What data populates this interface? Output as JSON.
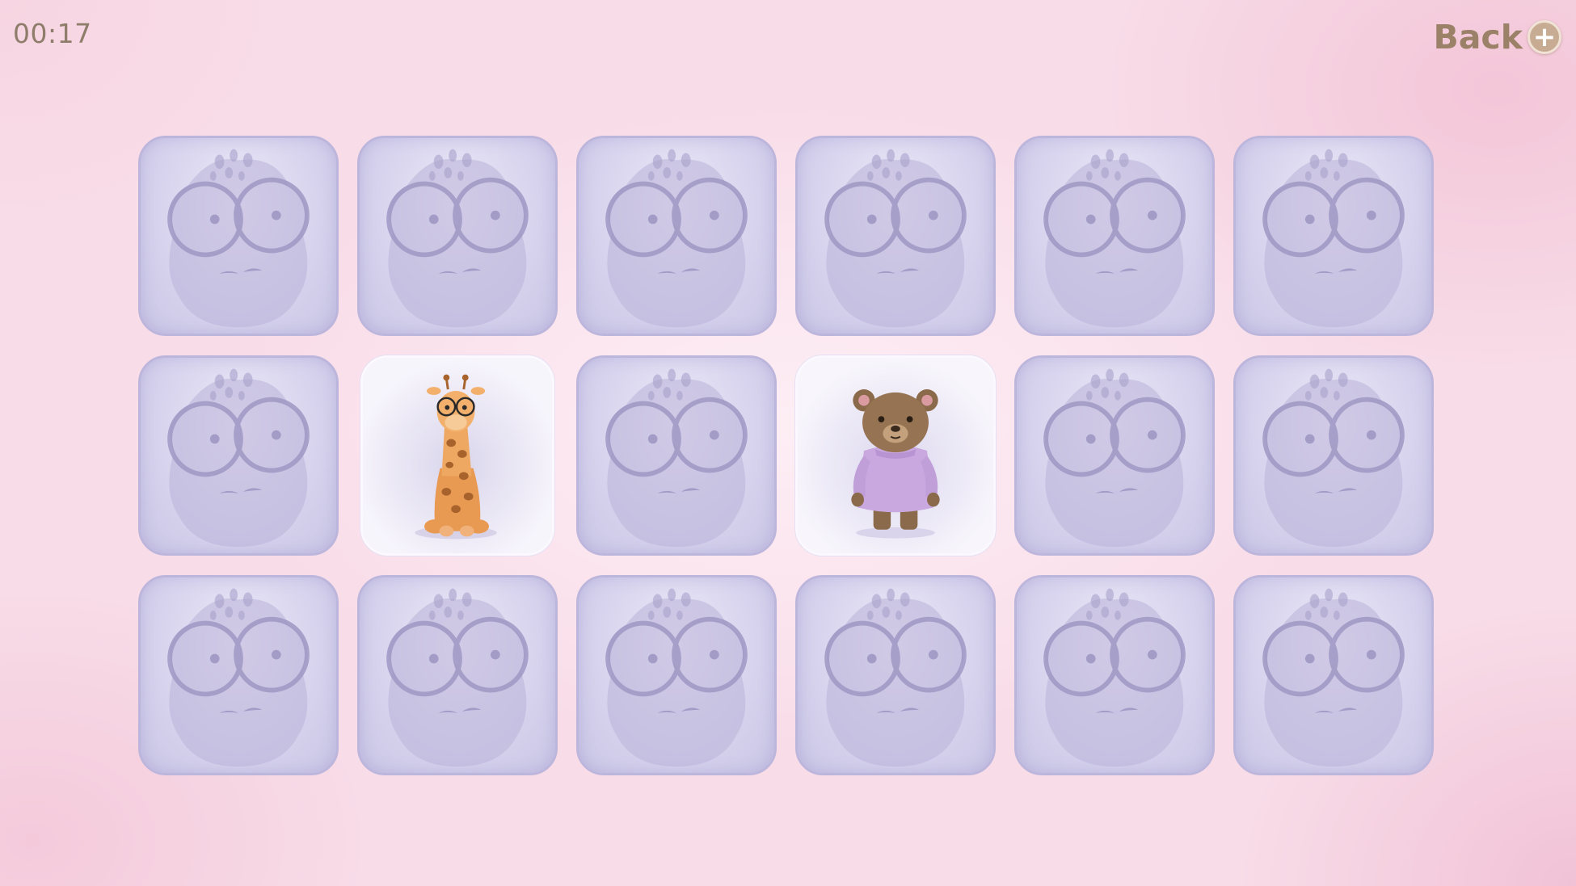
{
  "header": {
    "timer": "00:17",
    "back_label": "Back",
    "back_icon": "plus-circle-icon"
  },
  "board": {
    "rows": 3,
    "columns": 6,
    "cards": [
      {
        "state": "face-down",
        "image": "giraffe-silhouette-back"
      },
      {
        "state": "face-down",
        "image": "giraffe-silhouette-back"
      },
      {
        "state": "face-down",
        "image": "giraffe-silhouette-back"
      },
      {
        "state": "face-down",
        "image": "giraffe-silhouette-back"
      },
      {
        "state": "face-down",
        "image": "giraffe-silhouette-back"
      },
      {
        "state": "face-down",
        "image": "giraffe-silhouette-back"
      },
      {
        "state": "face-down",
        "image": "giraffe-silhouette-back"
      },
      {
        "state": "face-up",
        "image": "giraffe-with-glasses"
      },
      {
        "state": "face-down",
        "image": "giraffe-silhouette-back"
      },
      {
        "state": "face-up",
        "image": "bear-in-purple-sweater"
      },
      {
        "state": "face-down",
        "image": "giraffe-silhouette-back"
      },
      {
        "state": "face-down",
        "image": "giraffe-silhouette-back"
      },
      {
        "state": "face-down",
        "image": "giraffe-silhouette-back"
      },
      {
        "state": "face-down",
        "image": "giraffe-silhouette-back"
      },
      {
        "state": "face-down",
        "image": "giraffe-silhouette-back"
      },
      {
        "state": "face-down",
        "image": "giraffe-silhouette-back"
      },
      {
        "state": "face-down",
        "image": "giraffe-silhouette-back"
      },
      {
        "state": "face-down",
        "image": "giraffe-silhouette-back"
      }
    ]
  },
  "colors": {
    "background": "#f8dce8",
    "card_back": "#d8d4ee",
    "card_front": "#f5f2fb",
    "text": "#8f7d6b"
  }
}
